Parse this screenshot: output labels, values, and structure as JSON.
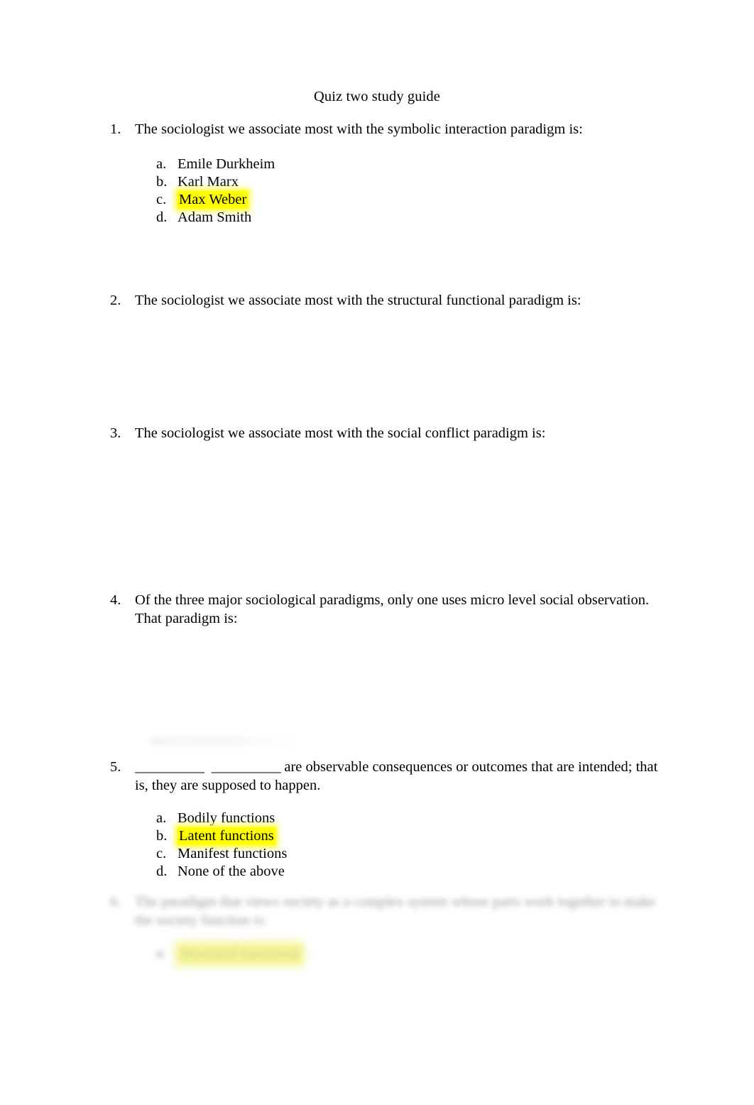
{
  "document": {
    "title": "Quiz two study guide",
    "highlight_color": "#ffff00",
    "background_color": "#ffffff",
    "text_color": "#000000"
  },
  "questions": [
    {
      "number": "1.",
      "text": "The sociologist we associate most with the symbolic interaction paradigm is:",
      "options": [
        {
          "letter": "a.",
          "text": "Emile Durkheim",
          "highlighted": false
        },
        {
          "letter": "b.",
          "text": "Karl Marx",
          "highlighted": false
        },
        {
          "letter": "c.",
          "text": "Max Weber",
          "highlighted": true
        },
        {
          "letter": "d.",
          "text": "Adam Smith",
          "highlighted": false
        }
      ]
    },
    {
      "number": "2.",
      "text": "The sociologist we associate most with the structural functional paradigm is:",
      "options": []
    },
    {
      "number": "3.",
      "text": "The sociologist we associate most with the social conflict paradigm is:",
      "options": []
    },
    {
      "number": "4.",
      "text": "Of the three major sociological paradigms, only one uses micro level social observation. That paradigm is:",
      "options": []
    },
    {
      "number": "5.",
      "blank_one": "__________",
      "blank_two": "__________",
      "text": " are observable consequences or outcomes that are intended; that is, they are supposed to happen.",
      "options": [
        {
          "letter": "a.",
          "text": "Bodily functions",
          "highlighted": false
        },
        {
          "letter": "b.",
          "text": "Latent functions",
          "highlighted": true
        },
        {
          "letter": "c.",
          "text": "Manifest functions",
          "highlighted": false
        },
        {
          "letter": "d.",
          "text": "None of the above",
          "highlighted": false
        }
      ]
    },
    {
      "number": "6.",
      "text": "The paradigm that views society as a complex system whose parts work together to make the society function is:",
      "blurred": true,
      "options": [
        {
          "letter": "a.",
          "text": "Structural functional",
          "highlighted": true,
          "blurred": true
        }
      ]
    }
  ]
}
